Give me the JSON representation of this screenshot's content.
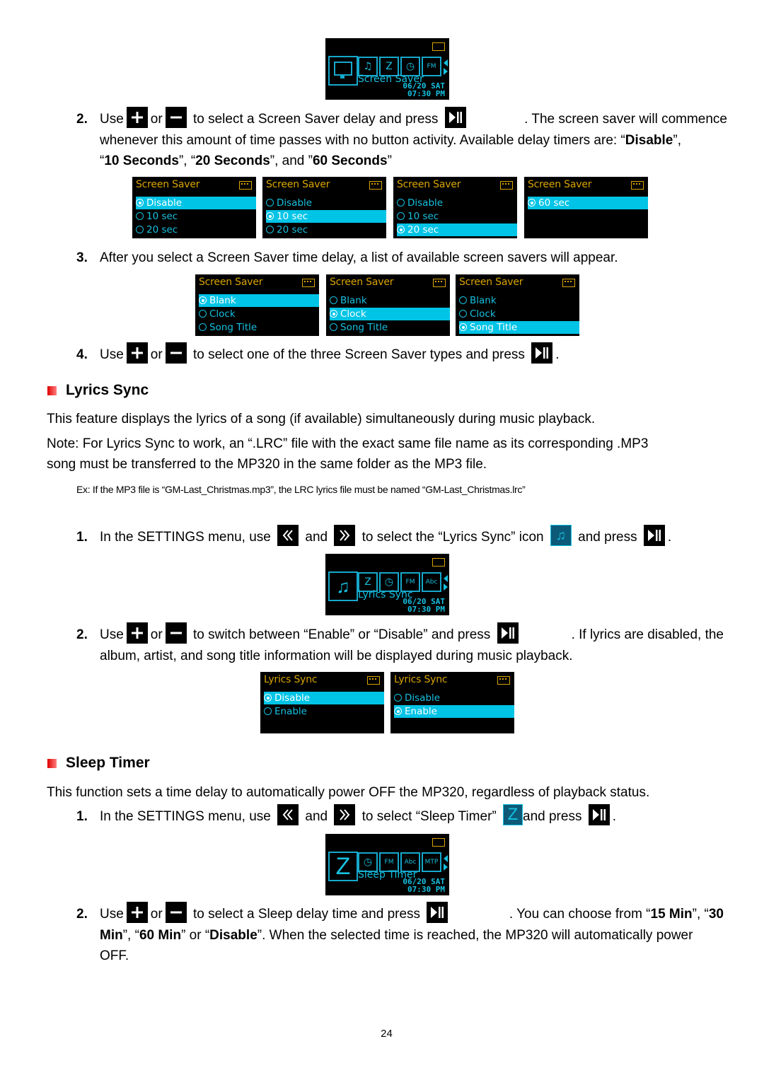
{
  "screen_saver_device": {
    "label": "Screen Saver",
    "date": "06/20",
    "day": "SAT",
    "time": "07:30",
    "ampm": "PM"
  },
  "step2": {
    "num": "2.",
    "use": "Use",
    "or": "or",
    "text1": "to select a Screen Saver delay and press",
    "text2": ". The screen saver will commence",
    "line2a": "whenever this amount of time passes with no button activity. Available delay timers are: “",
    "disable": "Disable",
    "line2b": "”,",
    "q1": "“",
    "s10": "10 Seconds",
    "q2": "”, “",
    "s20": "20 Seconds",
    "q3": "”, and ”",
    "s60": "60 Seconds",
    "q4": "”"
  },
  "delay_menus": [
    {
      "title": "Screen Saver",
      "items": [
        "Disable",
        "10 sec",
        "20 sec"
      ],
      "selected": 0
    },
    {
      "title": "Screen Saver",
      "items": [
        "Disable",
        "10 sec",
        "20 sec"
      ],
      "selected": 1
    },
    {
      "title": "Screen Saver",
      "items": [
        "Disable",
        "10 sec",
        "20 sec"
      ],
      "selected": 2
    },
    {
      "title": "Screen Saver",
      "items": [
        "60 sec"
      ],
      "selected": 0
    }
  ],
  "step3": {
    "num": "3.",
    "text": "After you select a Screen Saver time delay, a list of available screen savers will appear."
  },
  "type_menus": [
    {
      "title": "Screen Saver",
      "items": [
        "Blank",
        "Clock",
        "Song Title"
      ],
      "selected": 0
    },
    {
      "title": "Screen Saver",
      "items": [
        "Blank",
        "Clock",
        "Song Title"
      ],
      "selected": 1
    },
    {
      "title": "Screen Saver",
      "items": [
        "Blank",
        "Clock",
        "Song Title"
      ],
      "selected": 2
    }
  ],
  "step4": {
    "num": "4.",
    "use": "Use",
    "or": "or",
    "text": "to select one of the three Screen Saver types and press",
    "end": "."
  },
  "lyrics": {
    "heading": "Lyrics Sync",
    "desc": "This feature displays the lyrics of a song (if available) simultaneously during music playback.",
    "note1": "Note: For Lyrics Sync to work, an “.LRC” file with the exact same file name as its corresponding .MP3",
    "note2": "song must be transferred to the MP320 in the same folder as the MP3 file.",
    "example": "Ex: If the MP3 file is “GM-Last_Christmas.mp3”, the LRC lyrics file must be named “GM-Last_Christmas.lrc”",
    "step1": {
      "num": "1.",
      "a": "In the SETTINGS menu, use",
      "and": "and",
      "b": "to select the “Lyrics Sync” icon",
      "c": "and press",
      "end": "."
    },
    "device": {
      "label": "Lyrics Sync",
      "date": "06/20",
      "day": "SAT",
      "time": "07:30",
      "ampm": "PM"
    },
    "step2": {
      "num": "2.",
      "use": "Use",
      "or": "or",
      "a": "to switch between “Enable” or “Disable” and press",
      "b": ". If lyrics are disabled, the",
      "line2": "album, artist, and song title information will be displayed during music playback."
    },
    "menus": [
      {
        "title": "Lyrics Sync",
        "items": [
          "Disable",
          "Enable"
        ],
        "selected": 0
      },
      {
        "title": "Lyrics Sync",
        "items": [
          "Disable",
          "Enable"
        ],
        "selected": 1
      }
    ]
  },
  "sleep": {
    "heading": "Sleep Timer",
    "desc": "This function sets a time delay to automatically power OFF the MP320, regardless of playback status.",
    "step1": {
      "num": "1.",
      "a": "In the SETTINGS menu, use",
      "and": "and",
      "b": "to select “Sleep Timer”",
      "c": "and press",
      "end": "."
    },
    "device": {
      "label": "Sleep Timer",
      "date": "06/20",
      "day": "SAT",
      "time": "07:30",
      "ampm": "PM"
    },
    "step2": {
      "num": "2.",
      "use": "Use",
      "or": "or",
      "a": "to select a Sleep delay time and press",
      "b": ". You can choose from “",
      "m15": "15 Min",
      "c": "”, “",
      "m30a": "30",
      "m30b": "Min",
      "d": "”, “",
      "m60": "60 Min",
      "e": "” or “",
      "dis": "Disable",
      "f": "”. When the selected time is reached, the MP320 will automatically power",
      "g": "OFF."
    }
  },
  "page_number": "24",
  "colors": {
    "screen_bg": "#000000",
    "screen_text": "#16c0e0",
    "highlight": "#00c4e6",
    "title_text": "#d9a400",
    "bullet": "#e00000"
  }
}
